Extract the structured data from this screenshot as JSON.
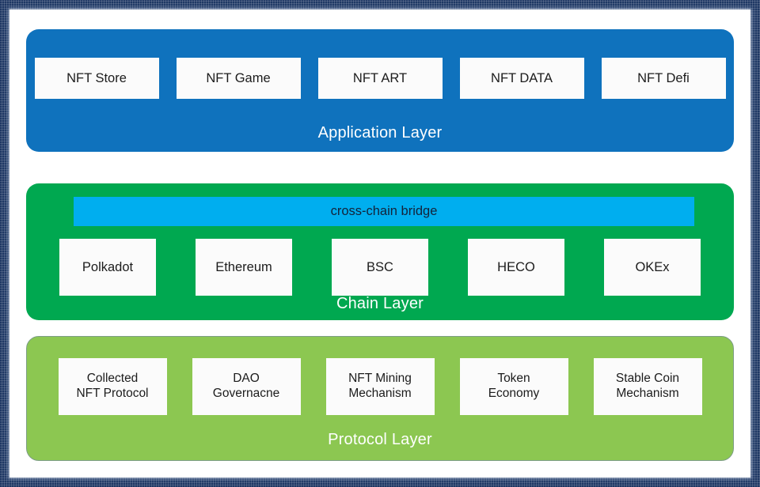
{
  "diagram": {
    "frame_color": "#1f3864",
    "canvas_color": "#ffffff",
    "layers": [
      {
        "id": "application",
        "caption": "Application Layer",
        "color": "#0f72bd",
        "caption_color": "#ffffff",
        "boxes": [
          {
            "label": "NFT Store"
          },
          {
            "label": "NFT Game"
          },
          {
            "label": "NFT ART"
          },
          {
            "label": "NFT DATA"
          },
          {
            "label": "NFT Defi"
          }
        ]
      },
      {
        "id": "chain",
        "caption": "Chain Layer",
        "color": "#00a850",
        "caption_color": "#ffffff",
        "bridge": {
          "label": "cross-chain bridge",
          "color": "#00aeef"
        },
        "boxes": [
          {
            "label": "Polkadot"
          },
          {
            "label": "Ethereum"
          },
          {
            "label": "BSC"
          },
          {
            "label": "HECO"
          },
          {
            "label": "OKEx"
          }
        ]
      },
      {
        "id": "protocol",
        "caption": "Protocol Layer",
        "color": "#8cc751",
        "caption_color": "#ffffff",
        "boxes": [
          {
            "line1": "Collected",
            "line2": "NFT Protocol"
          },
          {
            "line1": "DAO",
            "line2": "Governacne"
          },
          {
            "line1": "NFT Mining",
            "line2": "Mechanism"
          },
          {
            "line1": "Token",
            "line2": "Economy"
          },
          {
            "line1": "Stable Coin",
            "line2": "Mechanism"
          }
        ]
      }
    ]
  }
}
